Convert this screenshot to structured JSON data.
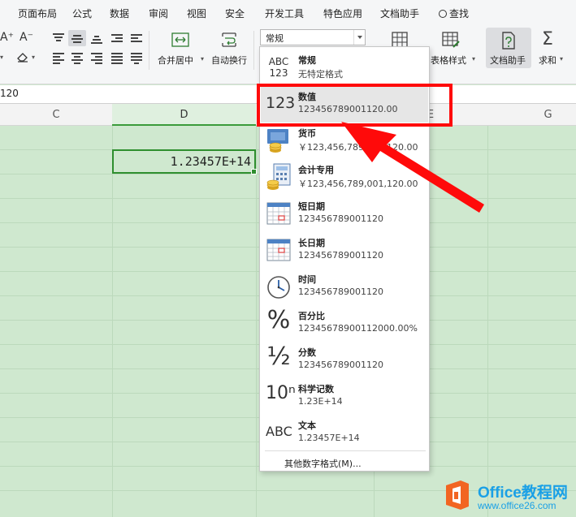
{
  "menu": {
    "tabs": [
      "页面布局",
      "公式",
      "数据",
      "审阅",
      "视图",
      "安全",
      "开发工具",
      "特色应用",
      "文档助手"
    ],
    "search_label": "查找"
  },
  "ribbon": {
    "font_grow": "A⁺",
    "font_shrink": "A⁻",
    "merge_center": "合并居中",
    "wrap_text": "自动换行",
    "number_format_value": "常规",
    "table_style": "表格样式",
    "doc_helper": "文档助手",
    "sum": "求和"
  },
  "formula_bar": {
    "value": "120"
  },
  "sheet": {
    "columns": [
      "C",
      "D",
      "E",
      "G"
    ],
    "selected_column": "D",
    "active_cell_value": "1.23457E+14"
  },
  "number_format_menu": {
    "items": [
      {
        "icon": "abc-123-icon",
        "icon_text": "ABC\n123",
        "name": "常规",
        "sample": "无特定格式"
      },
      {
        "icon": "number-123-icon",
        "icon_text": "123",
        "name": "数值",
        "sample": "123456789001120.00"
      },
      {
        "icon": "currency-coins-icon",
        "name": "货币",
        "sample": "￥123,456,789,001,120.00"
      },
      {
        "icon": "calculator-coins-icon",
        "name": "会计专用",
        "sample": "￥123,456,789,001,120.00"
      },
      {
        "icon": "calendar-short-icon",
        "name": "短日期",
        "sample": "123456789001120"
      },
      {
        "icon": "calendar-long-icon",
        "name": "长日期",
        "sample": "123456789001120"
      },
      {
        "icon": "clock-icon",
        "name": "时间",
        "sample": "123456789001120"
      },
      {
        "icon": "percent-icon",
        "icon_text": "%",
        "name": "百分比",
        "sample": "12345678900112000.00%"
      },
      {
        "icon": "fraction-icon",
        "icon_text": "½",
        "name": "分数",
        "sample": "123456789001120"
      },
      {
        "icon": "scientific-icon",
        "icon_text": "10ⁿ",
        "name": "科学记数",
        "sample": "1.23E+14"
      },
      {
        "icon": "text-abc-icon",
        "icon_text": "ABC",
        "name": "文本",
        "sample": "1.23457E+14"
      }
    ],
    "highlighted_index": 1,
    "more_formats": "其他数字格式(M)..."
  },
  "watermark": {
    "title": "Office教程网",
    "url": "www.office26.com"
  },
  "colors": {
    "sheet_bg": "#cfe8cf",
    "annotation_red": "#ff0a0a",
    "watermark_blue": "#1aa0e6",
    "logo_orange": "#f26522"
  }
}
